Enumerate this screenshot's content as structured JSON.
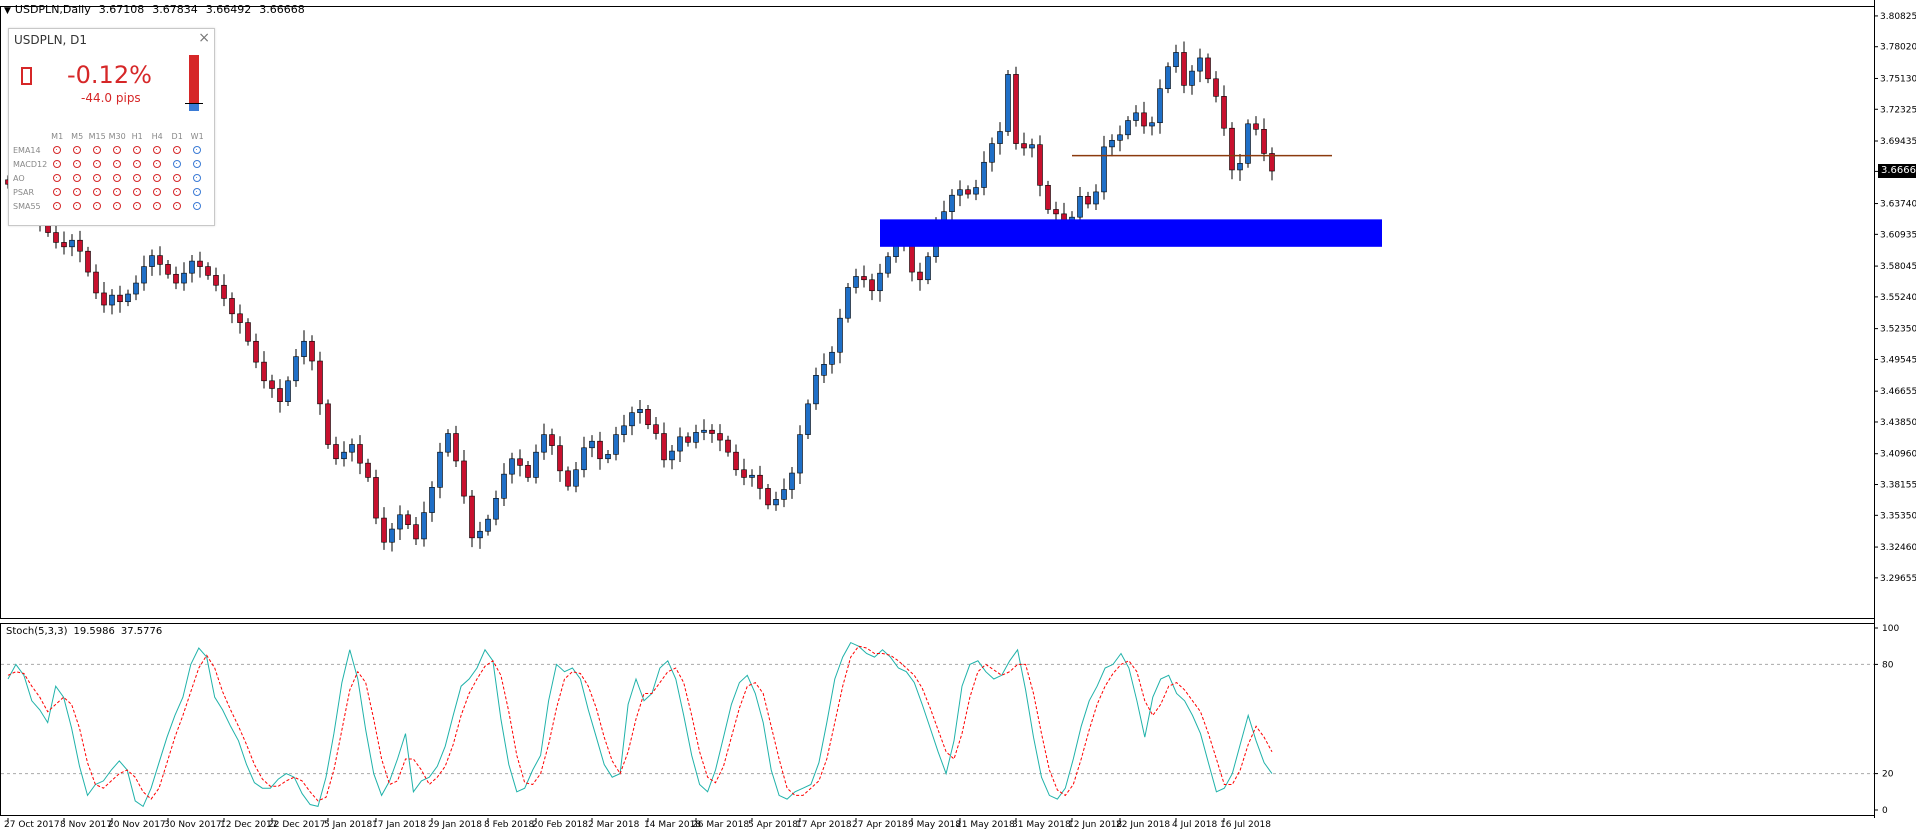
{
  "header": {
    "symbol": "USDPLN,Daily",
    "open": "3.67108",
    "high": "3.67834",
    "low": "3.66492",
    "close": "3.66668"
  },
  "current_price": "3.66668",
  "panel": {
    "title": "USDPLN, D1",
    "close_icon": "×",
    "change_pct": "-0.12%",
    "change_pips": "-44.0 pips",
    "direction_icon": "down-arrow-icon",
    "columns": [
      "M1",
      "M5",
      "M15",
      "M30",
      "H1",
      "H4",
      "D1",
      "W1"
    ],
    "rows": [
      {
        "name": "EMA14",
        "signals": [
          "red",
          "red",
          "red",
          "red",
          "red",
          "red",
          "red",
          "blue"
        ]
      },
      {
        "name": "MACD12",
        "signals": [
          "red",
          "red",
          "red",
          "red",
          "red",
          "red",
          "blue",
          "blue"
        ]
      },
      {
        "name": "AO",
        "signals": [
          "red",
          "red",
          "red",
          "red",
          "red",
          "red",
          "red",
          "blue"
        ]
      },
      {
        "name": "PSAR",
        "signals": [
          "red",
          "red",
          "red",
          "red",
          "red",
          "red",
          "red",
          "blue"
        ]
      },
      {
        "name": "SMA55",
        "signals": [
          "red",
          "red",
          "red",
          "red",
          "red",
          "red",
          "red",
          "blue"
        ]
      }
    ],
    "colors": {
      "bear": "#d62728",
      "bull": "#3a7bd5"
    }
  },
  "stoch_header": {
    "name": "Stoch(5,3,3)",
    "main": "19.5986",
    "signal": "37.5776"
  },
  "colors": {
    "bull": "#1f6fc7",
    "bear": "#c8102e",
    "zone": "#0000ff",
    "level_line": "#8b3a0e",
    "stoch_main": "#20b2aa",
    "stoch_signal": "#ff0000"
  },
  "chart_data": [
    {
      "type": "candlestick",
      "title": "USDPLN,Daily",
      "ylim": [
        3.26,
        3.81
      ],
      "y_ticks": [
        "3.80825",
        "3.78020",
        "3.75130",
        "3.72325",
        "3.69435",
        "3.66668",
        "3.63740",
        "3.60935",
        "3.58045",
        "3.55240",
        "3.52350",
        "3.49545",
        "3.46655",
        "3.43850",
        "3.40960",
        "3.38155",
        "3.35350",
        "3.32460",
        "3.29655"
      ],
      "x_tick_labels": [
        "27 Oct 2017",
        "8 Nov 2017",
        "20 Nov 2017",
        "30 Nov 2017",
        "12 Dec 2017",
        "22 Dec 2017",
        "5 Jan 2018",
        "17 Jan 2018",
        "29 Jan 2018",
        "8 Feb 2018",
        "20 Feb 2018",
        "2 Mar 2018",
        "14 Mar 2018",
        "26 Mar 2018",
        "5 Apr 2018",
        "17 Apr 2018",
        "27 Apr 2018",
        "9 May 2018",
        "21 May 2018",
        "31 May 2018",
        "12 Jun 2018",
        "22 Jun 2018",
        "4 Jul 2018",
        "16 Jul 2018"
      ],
      "close_path": [
        3.655,
        3.648,
        3.64,
        3.63,
        3.622,
        3.611,
        3.602,
        3.598,
        3.604,
        3.594,
        3.575,
        3.556,
        3.545,
        3.554,
        3.548,
        3.555,
        3.565,
        3.58,
        3.59,
        3.582,
        3.573,
        3.565,
        3.574,
        3.585,
        3.58,
        3.572,
        3.563,
        3.551,
        3.537,
        3.529,
        3.512,
        3.493,
        3.476,
        3.469,
        3.457,
        3.476,
        3.498,
        3.512,
        3.494,
        3.455,
        3.418,
        3.405,
        3.411,
        3.418,
        3.401,
        3.388,
        3.351,
        3.329,
        3.341,
        3.354,
        3.345,
        3.332,
        3.356,
        3.379,
        3.411,
        3.428,
        3.403,
        3.371,
        3.333,
        3.339,
        3.35,
        3.369,
        3.391,
        3.405,
        3.399,
        3.388,
        3.411,
        3.427,
        3.417,
        3.394,
        3.38,
        3.395,
        3.415,
        3.421,
        3.405,
        3.409,
        3.427,
        3.435,
        3.447,
        3.45,
        3.436,
        3.428,
        3.404,
        3.412,
        3.425,
        3.42,
        3.429,
        3.431,
        3.428,
        3.422,
        3.411,
        3.395,
        3.388,
        3.39,
        3.378,
        3.363,
        3.368,
        3.377,
        3.392,
        3.427,
        3.455,
        3.481,
        3.491,
        3.502,
        3.533,
        3.561,
        3.571,
        3.568,
        3.558,
        3.574,
        3.589,
        3.607,
        3.601,
        3.575,
        3.568,
        3.589,
        3.618,
        3.63,
        3.645,
        3.65,
        3.646,
        3.652,
        3.675,
        3.692,
        3.703,
        3.755,
        3.692,
        3.688,
        3.691,
        3.654,
        3.632,
        3.628,
        3.618,
        3.625,
        3.644,
        3.637,
        3.648,
        3.689,
        3.695,
        3.7,
        3.713,
        3.72,
        3.708,
        3.711,
        3.742,
        3.762,
        3.775,
        3.745,
        3.758,
        3.77,
        3.751,
        3.735,
        3.706,
        3.668,
        3.674,
        3.71,
        3.705,
        3.683,
        3.667
      ],
      "zone": {
        "from_date": "5 May 2018",
        "to_date": "24 Jul 2018",
        "y_low": 3.598,
        "y_high": 3.623
      },
      "level_line": {
        "from_date": "12 Jun 2018",
        "to_date": "25 Jul 2018",
        "y": 3.681
      }
    },
    {
      "type": "line",
      "title": "Stoch(5,3,3)",
      "ylim": [
        0,
        100
      ],
      "y_ticks": [
        "100",
        "80",
        "20",
        "0"
      ],
      "series": [
        {
          "name": "main",
          "values": [
            72,
            80,
            74,
            60,
            55,
            48,
            68,
            62,
            45,
            24,
            8,
            14,
            16,
            22,
            27,
            22,
            5,
            2,
            12,
            26,
            40,
            52,
            62,
            80,
            89,
            84,
            62,
            55,
            46,
            38,
            25,
            15,
            12,
            12,
            17,
            20,
            18,
            9,
            3,
            2,
            18,
            42,
            70,
            88,
            72,
            44,
            20,
            8,
            16,
            28,
            42,
            10,
            16,
            18,
            24,
            35,
            52,
            68,
            72,
            78,
            88,
            82,
            50,
            25,
            10,
            12,
            22,
            30,
            60,
            80,
            76,
            78,
            72,
            55,
            40,
            25,
            18,
            20,
            58,
            72,
            60,
            64,
            78,
            82,
            72,
            52,
            30,
            14,
            10,
            22,
            40,
            58,
            70,
            74,
            64,
            48,
            22,
            8,
            6,
            10,
            12,
            14,
            26,
            48,
            72,
            84,
            92,
            90,
            86,
            84,
            88,
            84,
            78,
            76,
            70,
            58,
            45,
            32,
            20,
            38,
            68,
            80,
            82,
            76,
            72,
            74,
            82,
            88,
            66,
            40,
            18,
            8,
            6,
            12,
            28,
            46,
            60,
            68,
            78,
            80,
            86,
            78,
            60,
            40,
            62,
            72,
            74,
            64,
            60,
            52,
            42,
            26,
            10,
            12,
            20,
            36,
            52,
            38,
            26,
            20
          ]
        },
        {
          "name": "signal",
          "values": [
            74,
            76,
            75,
            68,
            62,
            54,
            58,
            62,
            58,
            45,
            26,
            14,
            12,
            16,
            20,
            22,
            18,
            10,
            6,
            12,
            26,
            40,
            52,
            65,
            78,
            85,
            78,
            65,
            55,
            46,
            36,
            25,
            17,
            13,
            13,
            16,
            18,
            16,
            10,
            5,
            7,
            22,
            44,
            66,
            76,
            70,
            50,
            28,
            14,
            16,
            28,
            28,
            22,
            14,
            18,
            24,
            36,
            52,
            64,
            72,
            79,
            82,
            74,
            54,
            30,
            15,
            14,
            20,
            36,
            56,
            72,
            76,
            75,
            68,
            56,
            40,
            27,
            20,
            32,
            50,
            64,
            64,
            70,
            76,
            78,
            70,
            52,
            32,
            18,
            15,
            24,
            40,
            56,
            68,
            70,
            64,
            46,
            28,
            12,
            8,
            8,
            12,
            16,
            28,
            48,
            68,
            84,
            90,
            89,
            86,
            86,
            85,
            82,
            78,
            74,
            67,
            56,
            44,
            32,
            28,
            42,
            62,
            76,
            80,
            77,
            74,
            76,
            80,
            80,
            64,
            42,
            22,
            11,
            8,
            14,
            28,
            44,
            58,
            68,
            75,
            80,
            82,
            76,
            60,
            52,
            58,
            68,
            70,
            66,
            60,
            54,
            42,
            28,
            14,
            14,
            22,
            36,
            46,
            40,
            32
          ]
        }
      ],
      "levels": [
        80,
        20
      ]
    }
  ]
}
